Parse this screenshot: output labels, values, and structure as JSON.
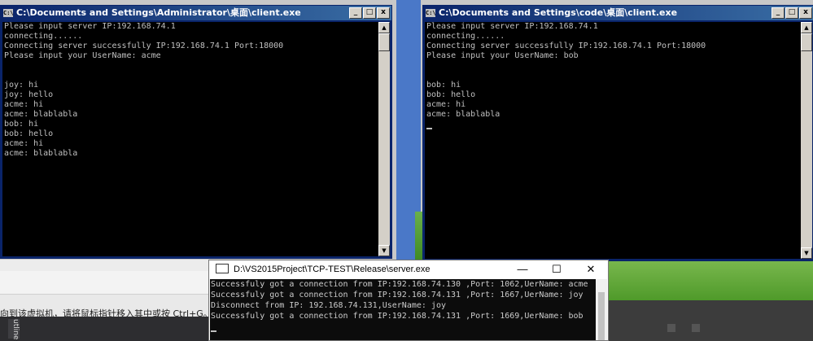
{
  "client1": {
    "title": "C:\\Documents and Settings\\Administrator\\桌面\\client.exe",
    "icon": "console-icon",
    "lines": [
      "Please input server IP:192.168.74.1",
      "connecting......",
      "Connecting server successfully IP:192.168.74.1 Port:18000",
      "Please input your UserName: acme",
      "",
      "",
      "joy: hi",
      "joy: hello",
      "acme: hi",
      "acme: blablabla",
      "bob: hi",
      "bob: hello",
      "acme: hi",
      "acme: blablabla"
    ]
  },
  "client2": {
    "title": "C:\\Documents and Settings\\code\\桌面\\client.exe",
    "icon": "console-icon",
    "lines": [
      "Please input server IP:192.168.74.1",
      "connecting......",
      "Connecting server successfully IP:192.168.74.1 Port:18000",
      "Please input your UserName: bob",
      "",
      "",
      "bob: hi",
      "bob: hello",
      "acme: hi",
      "acme: blablabla"
    ]
  },
  "server": {
    "title": "D:\\VS2015Project\\TCP-TEST\\Release\\server.exe",
    "lines": [
      "Successfuly got a connection from IP:192.168.74.130 ,Port: 1062,UerName: acme",
      "Successfuly got a connection from IP:192.168.74.131 ,Port: 1667,UerName: joy",
      "Disconnect from IP: 192.168.74.131,UserName: joy",
      "Successfuly got a connection from IP:192.168.74.131 ,Port: 1669,UerName: bob"
    ],
    "minimize": "—",
    "maximize": "☐",
    "close": "✕"
  },
  "vm_hint": "向到该虚拟机，请将鼠标指针移入其中或按 Ctrl+G。",
  "side_tab": "utline",
  "xp_buttons": {
    "minimize": "_",
    "maximize": "□",
    "close": "x"
  }
}
